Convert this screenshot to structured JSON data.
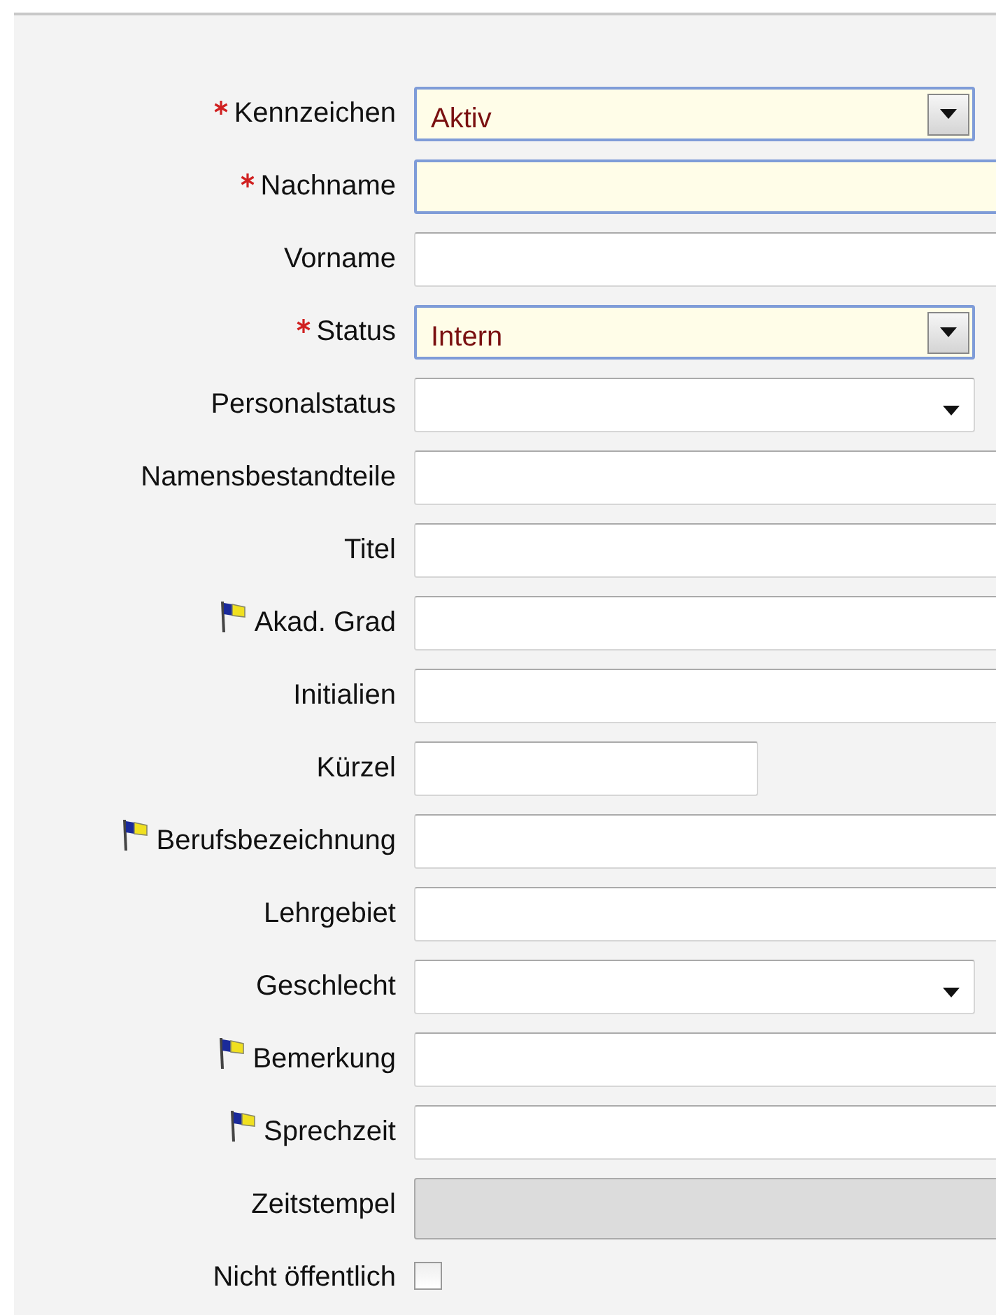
{
  "form": {
    "fields": [
      {
        "label": "Kennzeichen",
        "required": true,
        "flag": false,
        "kind": "select",
        "value": "Aktiv"
      },
      {
        "label": "Nachname",
        "required": true,
        "flag": false,
        "kind": "text"
      },
      {
        "label": "Vorname",
        "required": false,
        "flag": false,
        "kind": "text"
      },
      {
        "label": "Status",
        "required": true,
        "flag": false,
        "kind": "select",
        "value": "Intern"
      },
      {
        "label": "Personalstatus",
        "required": false,
        "flag": false,
        "kind": "dropdown"
      },
      {
        "label": "Namensbestandteile",
        "required": false,
        "flag": false,
        "kind": "text"
      },
      {
        "label": "Titel",
        "required": false,
        "flag": false,
        "kind": "text"
      },
      {
        "label": "Akad. Grad",
        "required": false,
        "flag": true,
        "kind": "text"
      },
      {
        "label": "Initialien",
        "required": false,
        "flag": false,
        "kind": "text"
      },
      {
        "label": "Kürzel",
        "required": false,
        "flag": false,
        "kind": "short_text"
      },
      {
        "label": "Berufsbezeichnung",
        "required": false,
        "flag": true,
        "kind": "text"
      },
      {
        "label": "Lehrgebiet",
        "required": false,
        "flag": false,
        "kind": "text"
      },
      {
        "label": "Geschlecht",
        "required": false,
        "flag": false,
        "kind": "dropdown"
      },
      {
        "label": "Bemerkung",
        "required": false,
        "flag": true,
        "kind": "text"
      },
      {
        "label": "Sprechzeit",
        "required": false,
        "flag": true,
        "kind": "text"
      },
      {
        "label": "Zeitstempel",
        "required": false,
        "flag": false,
        "kind": "text",
        "disabled": true
      },
      {
        "label": "Nicht öffentlich",
        "required": false,
        "flag": false,
        "kind": "checkbox",
        "checked": false
      }
    ]
  }
}
